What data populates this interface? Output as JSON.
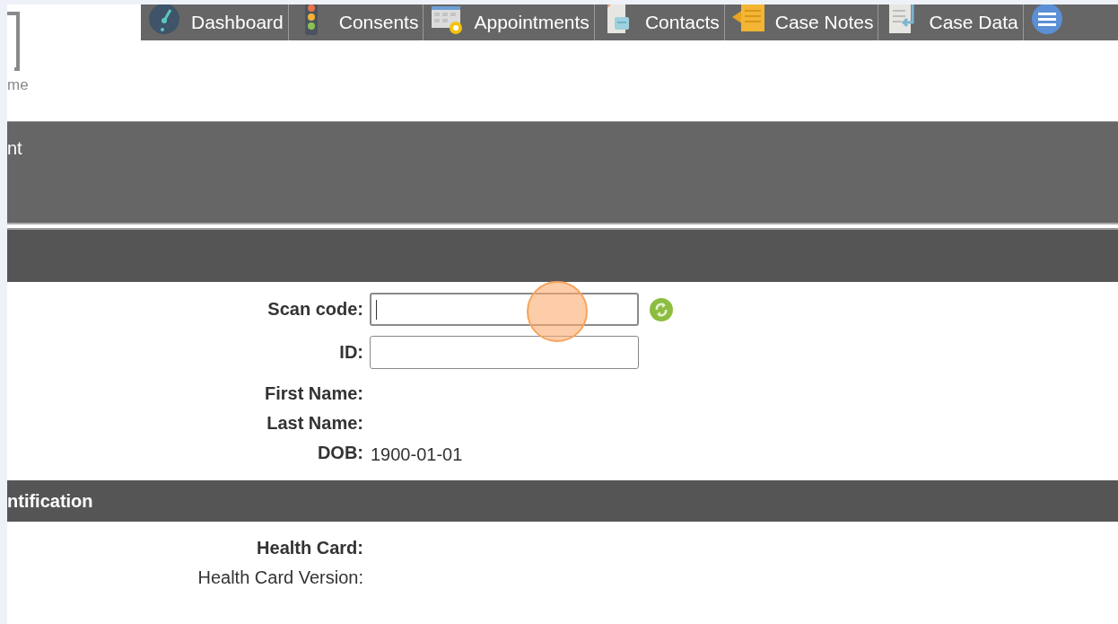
{
  "logo": {
    "caption": "me"
  },
  "nav": {
    "items": [
      {
        "label": "Dashboard"
      },
      {
        "label": "Consents"
      },
      {
        "label": "Appointments"
      },
      {
        "label": "Contacts"
      },
      {
        "label": "Case Notes"
      },
      {
        "label": "Case Data"
      }
    ]
  },
  "sections": [
    {
      "title": "nt",
      "kind": "tall"
    },
    {
      "kind": "band",
      "rows": [
        {
          "label": "Scan code:",
          "bold": true,
          "kind": "scan",
          "focused": true
        },
        {
          "label": "ID:",
          "bold": true,
          "kind": "input",
          "focused": false
        },
        {
          "label": "First Name:",
          "bold": true,
          "kind": "text"
        },
        {
          "label": "Last Name:",
          "bold": true,
          "kind": "text"
        },
        {
          "label": "DOB:",
          "bold": true,
          "kind": "text",
          "value": "1900-01-01"
        }
      ]
    },
    {
      "title": "ntification",
      "kind": "band",
      "rows": [
        {
          "label": "Health Card:",
          "bold": true,
          "kind": "text"
        },
        {
          "label": "Health Card Version:",
          "bold": false,
          "kind": "text"
        }
      ]
    }
  ]
}
